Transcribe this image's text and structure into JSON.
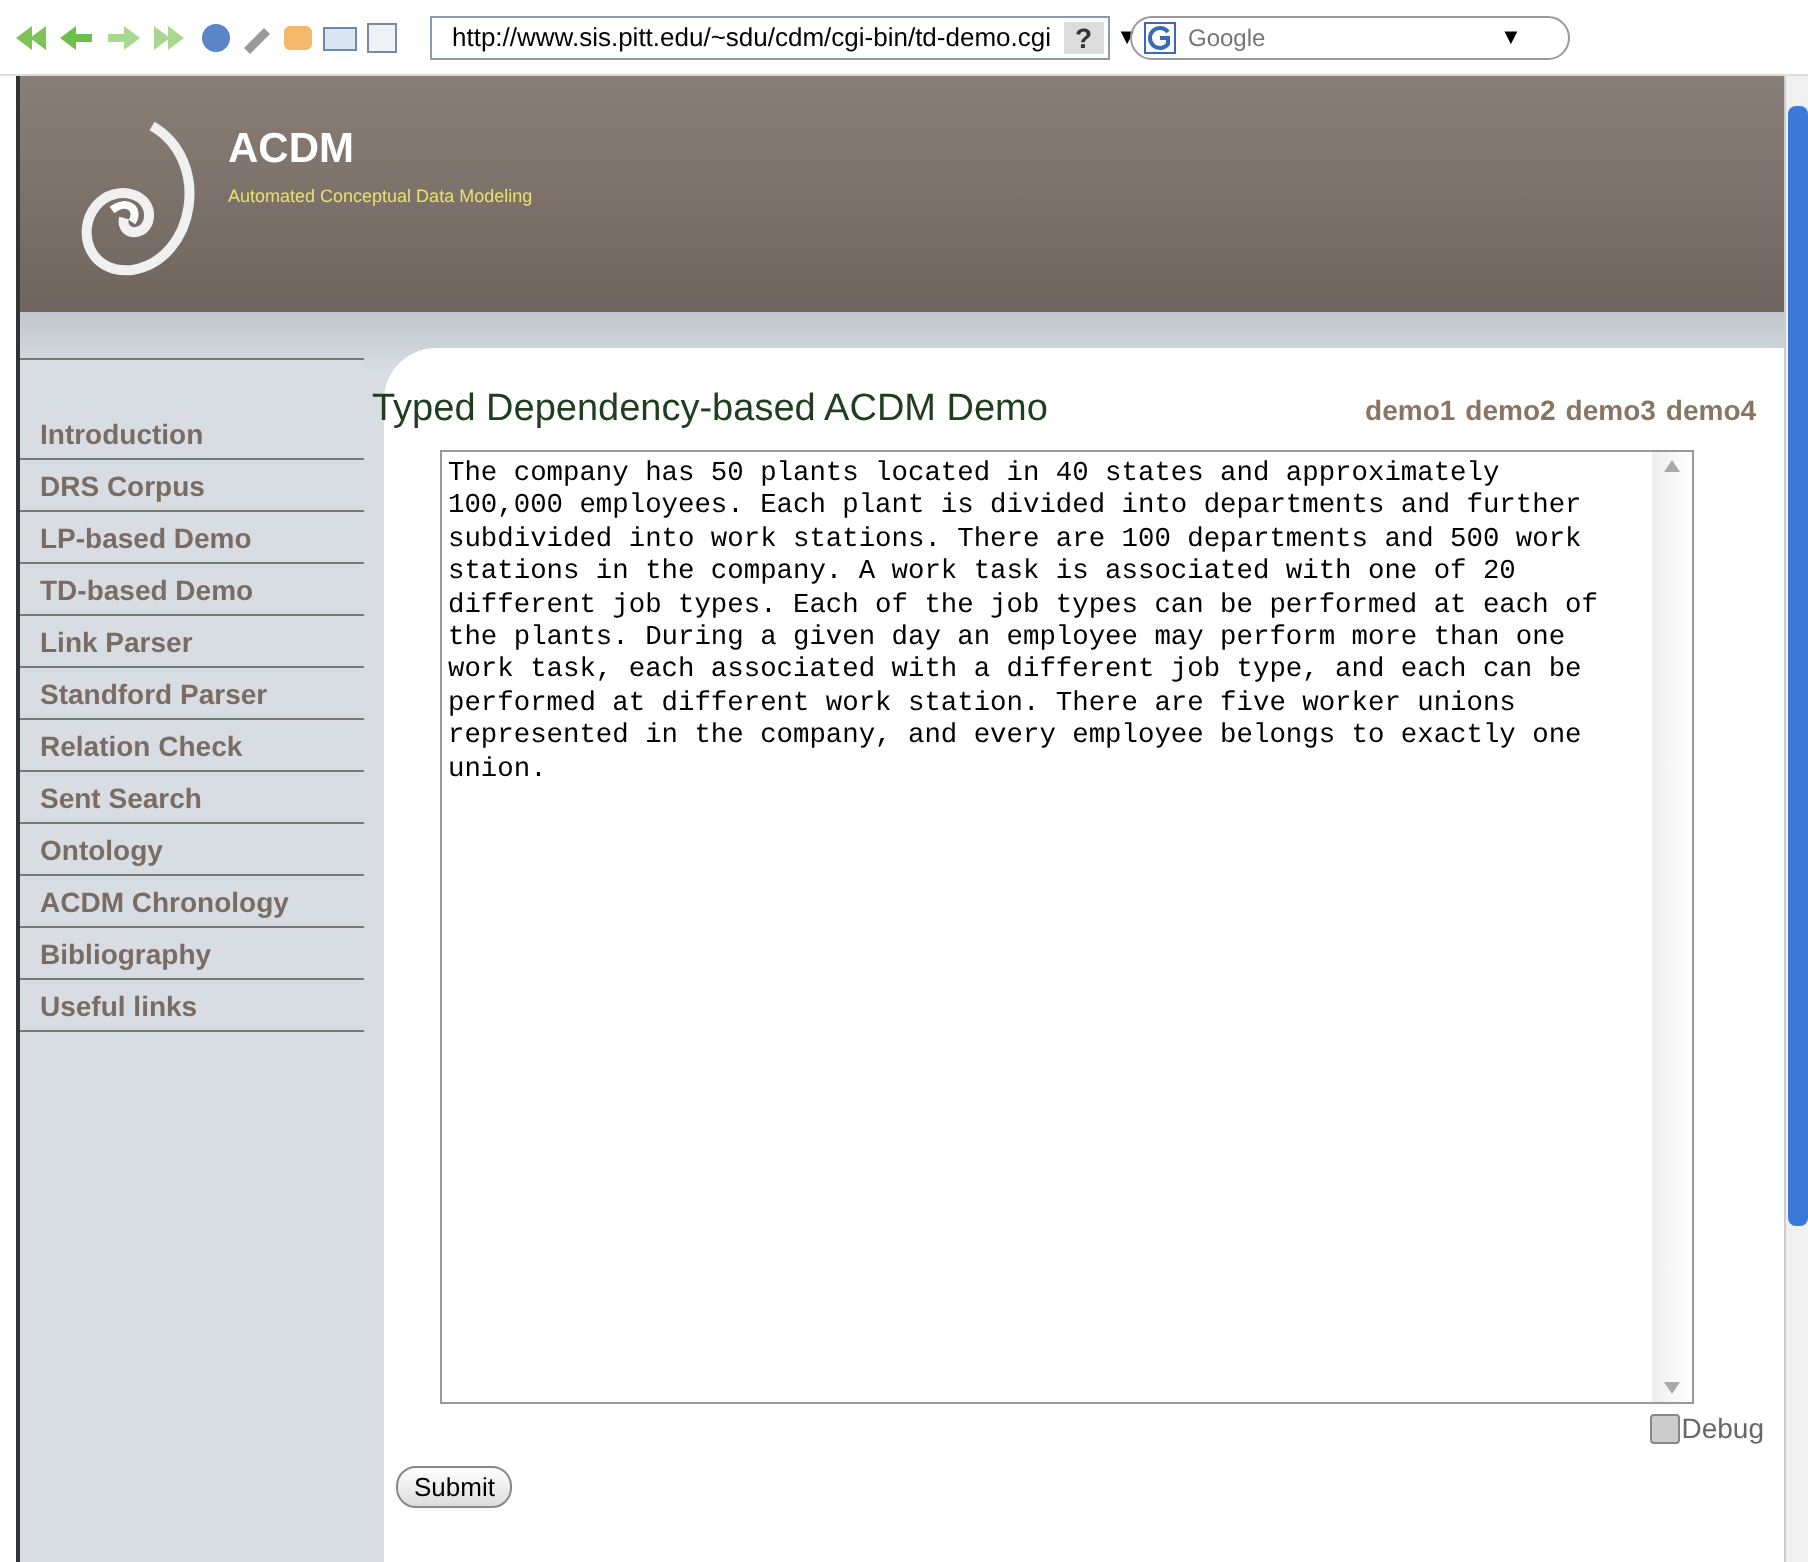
{
  "browser": {
    "url": "http://www.sis.pitt.edu/~sdu/cdm/cgi-bin/td-demo.cgi",
    "help": "?",
    "dropdown": "▼",
    "search": {
      "placeholder": "Google"
    },
    "search_dropdown": "▼"
  },
  "header": {
    "title": "ACDM",
    "subtitle": "Automated Conceptual Data Modeling"
  },
  "sidebar": {
    "items": [
      {
        "label": "Introduction"
      },
      {
        "label": "DRS Corpus"
      },
      {
        "label": "LP-based Demo"
      },
      {
        "label": "TD-based Demo"
      },
      {
        "label": "Link Parser"
      },
      {
        "label": "Standford Parser"
      },
      {
        "label": "Relation Check"
      },
      {
        "label": "Sent Search"
      },
      {
        "label": "Ontology"
      },
      {
        "label": "ACDM Chronology"
      },
      {
        "label": "Bibliography"
      },
      {
        "label": "Useful links"
      }
    ]
  },
  "main": {
    "title": "Typed Dependency-based ACDM Demo",
    "demos": [
      "demo1",
      "demo2",
      "demo3",
      "demo4"
    ],
    "input": {
      "value": "The company has 50 plants located in 40 states and approximately 100,000 employees. Each plant is divided into departments and further subdivided into work stations. There are 100 departments and 500 work stations in the company. A work task is associated with one of 20 different job types. Each of the job types can be performed at each of the plants. During a given day an employee may perform more than one work task, each associated with a different job type, and each can be performed at different work station. There are five worker unions represented in the company, and every employee belongs to exactly one union."
    },
    "debug": {
      "label": "Debug",
      "checked": false
    },
    "submit": "Submit"
  }
}
